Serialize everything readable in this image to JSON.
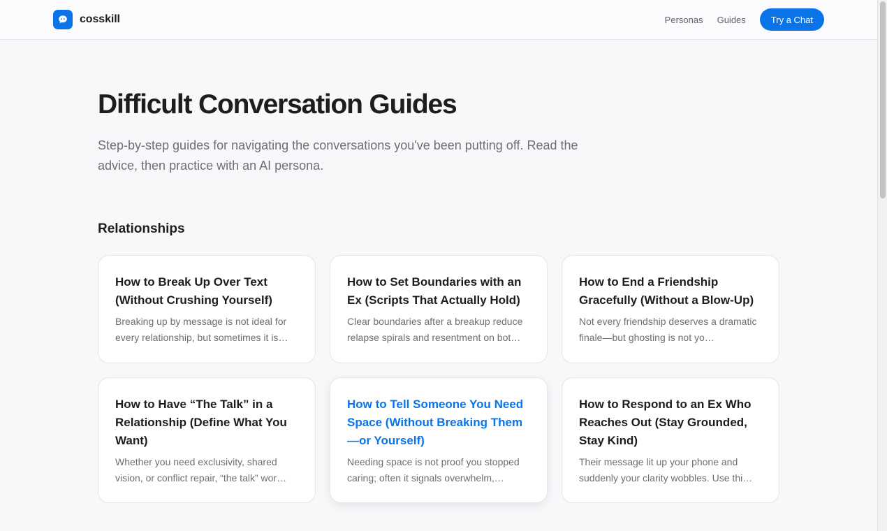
{
  "header": {
    "brand": "cosskill",
    "nav": [
      "Personas",
      "Guides"
    ],
    "cta": "Try a Chat",
    "accent": "#0a74e8"
  },
  "hero": {
    "title": "Difficult Conversation Guides",
    "lead": "Step-by-step guides for navigating the conversations you've been putting off. Read the advice, then practice with an AI persona."
  },
  "section": {
    "title": "Relationships",
    "cards": [
      {
        "title": "How to Break Up Over Text (Without Crushing Yourself)",
        "desc": "Breaking up by message is not ideal for every relationship, but sometimes it is…"
      },
      {
        "title": "How to Set Boundaries with an Ex (Scripts That Actually Hold)",
        "desc": "Clear boundaries after a breakup reduce relapse spirals and resentment on bot…"
      },
      {
        "title": "How to End a Friendship Gracefully (Without a Blow-Up)",
        "desc": "Not every friendship deserves a dramatic finale—but ghosting is not yo…"
      },
      {
        "title": "How to Have “The Talk” in a Relationship (Define What You Want)",
        "desc": "Whether you need exclusivity, shared vision, or conflict repair, “the talk” wor…"
      },
      {
        "title": "How to Tell Someone You Need Space (Without Breaking Them—or Yourself)",
        "desc": "Needing space is not proof you stopped caring; often it signals overwhelm,…"
      },
      {
        "title": "How to Respond to an Ex Who Reaches Out (Stay Grounded, Stay Kind)",
        "desc": "Their message lit up your phone and suddenly your clarity wobbles. Use thi…"
      }
    ]
  }
}
